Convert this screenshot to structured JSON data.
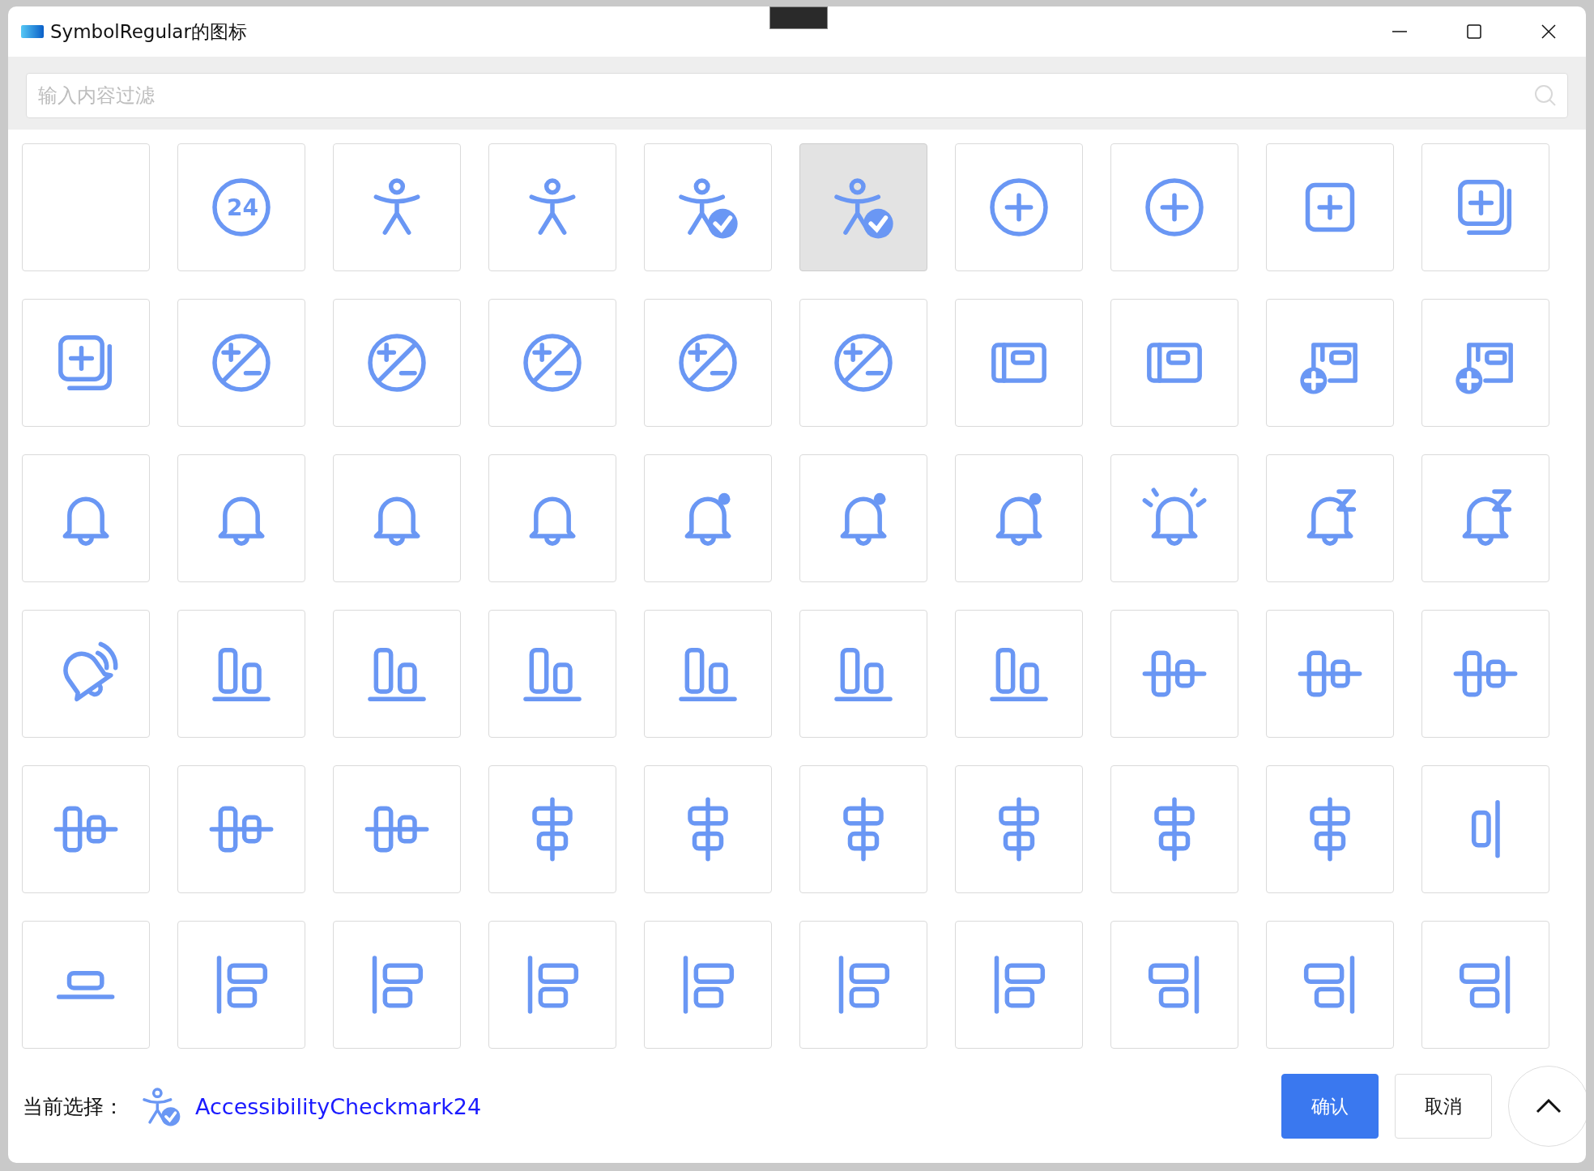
{
  "window": {
    "title": "SymbolRegular的图标"
  },
  "search": {
    "placeholder": "输入内容过滤"
  },
  "icons": [
    {
      "kind": "empty",
      "selected": false
    },
    {
      "kind": "circle-text",
      "text": "24",
      "selected": false
    },
    {
      "kind": "person",
      "selected": false
    },
    {
      "kind": "person",
      "selected": false
    },
    {
      "kind": "person-check",
      "selected": false
    },
    {
      "kind": "person-check",
      "selected": true
    },
    {
      "kind": "add-circle",
      "selected": false
    },
    {
      "kind": "add-circle",
      "selected": false
    },
    {
      "kind": "add-square",
      "selected": false
    },
    {
      "kind": "add-square-multiple",
      "selected": false
    },
    {
      "kind": "add-square-multiple",
      "selected": false
    },
    {
      "kind": "plus-minus",
      "selected": false
    },
    {
      "kind": "plus-minus",
      "selected": false
    },
    {
      "kind": "plus-minus",
      "selected": false
    },
    {
      "kind": "plus-minus",
      "selected": false
    },
    {
      "kind": "plus-minus",
      "selected": false
    },
    {
      "kind": "window",
      "selected": false
    },
    {
      "kind": "window",
      "selected": false
    },
    {
      "kind": "window-add",
      "selected": false
    },
    {
      "kind": "window-add",
      "selected": false
    },
    {
      "kind": "bell",
      "selected": false
    },
    {
      "kind": "bell",
      "selected": false
    },
    {
      "kind": "bell",
      "selected": false
    },
    {
      "kind": "bell",
      "selected": false
    },
    {
      "kind": "bell-dot",
      "selected": false
    },
    {
      "kind": "bell-dot",
      "selected": false
    },
    {
      "kind": "bell-dot",
      "selected": false
    },
    {
      "kind": "bell-alert",
      "selected": false
    },
    {
      "kind": "bell-snooze",
      "selected": false
    },
    {
      "kind": "bell-snooze",
      "selected": false
    },
    {
      "kind": "bell-sound",
      "selected": false
    },
    {
      "kind": "align-bottom",
      "selected": false
    },
    {
      "kind": "align-bottom",
      "selected": false
    },
    {
      "kind": "align-bottom",
      "selected": false
    },
    {
      "kind": "align-bottom",
      "selected": false
    },
    {
      "kind": "align-bottom",
      "selected": false
    },
    {
      "kind": "align-bottom",
      "selected": false
    },
    {
      "kind": "align-middle",
      "selected": false
    },
    {
      "kind": "align-middle",
      "selected": false
    },
    {
      "kind": "align-middle",
      "selected": false
    },
    {
      "kind": "align-middle",
      "selected": false
    },
    {
      "kind": "align-middle",
      "selected": false
    },
    {
      "kind": "align-middle",
      "selected": false
    },
    {
      "kind": "align-center",
      "selected": false
    },
    {
      "kind": "align-center",
      "selected": false
    },
    {
      "kind": "align-center",
      "selected": false
    },
    {
      "kind": "align-center",
      "selected": false
    },
    {
      "kind": "align-center",
      "selected": false
    },
    {
      "kind": "align-center",
      "selected": false
    },
    {
      "kind": "align-right-single",
      "selected": false
    },
    {
      "kind": "align-bottom-single",
      "selected": false
    },
    {
      "kind": "align-left",
      "selected": false
    },
    {
      "kind": "align-left",
      "selected": false
    },
    {
      "kind": "align-left",
      "selected": false
    },
    {
      "kind": "align-left",
      "selected": false
    },
    {
      "kind": "align-left",
      "selected": false
    },
    {
      "kind": "align-left",
      "selected": false
    },
    {
      "kind": "align-right",
      "selected": false
    },
    {
      "kind": "align-right",
      "selected": false
    },
    {
      "kind": "align-right",
      "selected": false
    }
  ],
  "footer": {
    "label": "当前选择：",
    "selected_name": "AccessibilityCheckmark24",
    "buttons": [
      {
        "label": "确认",
        "kind": "primary"
      },
      {
        "label": "取消",
        "kind": "secondary"
      }
    ]
  }
}
